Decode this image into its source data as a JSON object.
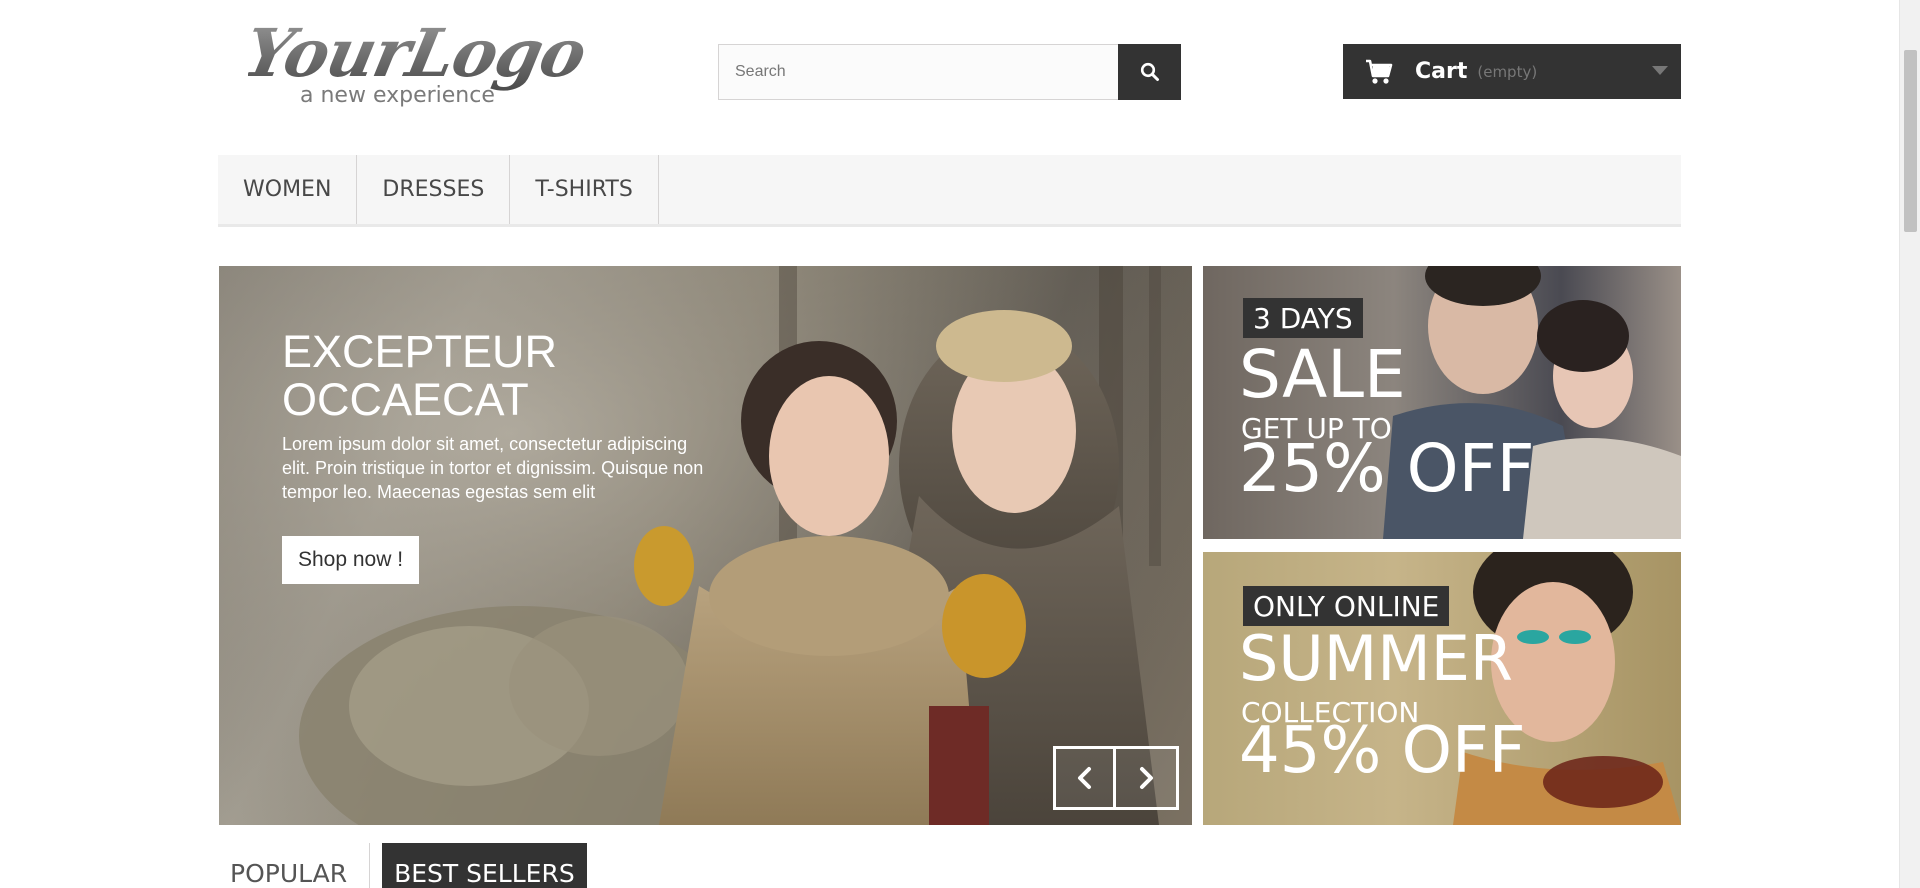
{
  "colors": {
    "dark": "#333333",
    "menu_bg": "#f6f6f6",
    "white": "#ffffff"
  },
  "logo": {
    "text": "YourLogo",
    "tagline": "a new experience"
  },
  "search": {
    "placeholder": "Search",
    "value": "",
    "button_icon": "search-icon"
  },
  "cart": {
    "icon": "shopping-cart-icon",
    "label": "Cart",
    "status": "(empty)",
    "dropdown_icon": "caret-down-icon"
  },
  "menu": {
    "items": [
      {
        "label": "Women"
      },
      {
        "label": "Dresses"
      },
      {
        "label": "T-shirts"
      }
    ]
  },
  "slider": {
    "title": "Excepteur occaecat",
    "text": "Lorem ipsum dolor sit amet, consectetur adipiscing elit. Proin tristique in tortor et dignissim. Quisque non tempor leo. Maecenas egestas sem elit",
    "button_label": "Shop now !",
    "prev_icon": "chevron-left-icon",
    "next_icon": "chevron-right-icon"
  },
  "banners": [
    {
      "tag": "3 Days",
      "line1": "Sale",
      "line2": "Get up to",
      "line3": "25% off"
    },
    {
      "tag": "Only online",
      "line1": "Summer",
      "line2": "Collection",
      "line3": "45% off"
    }
  ],
  "tabs": [
    {
      "label": "Popular"
    },
    {
      "label": "Best Sellers"
    }
  ]
}
